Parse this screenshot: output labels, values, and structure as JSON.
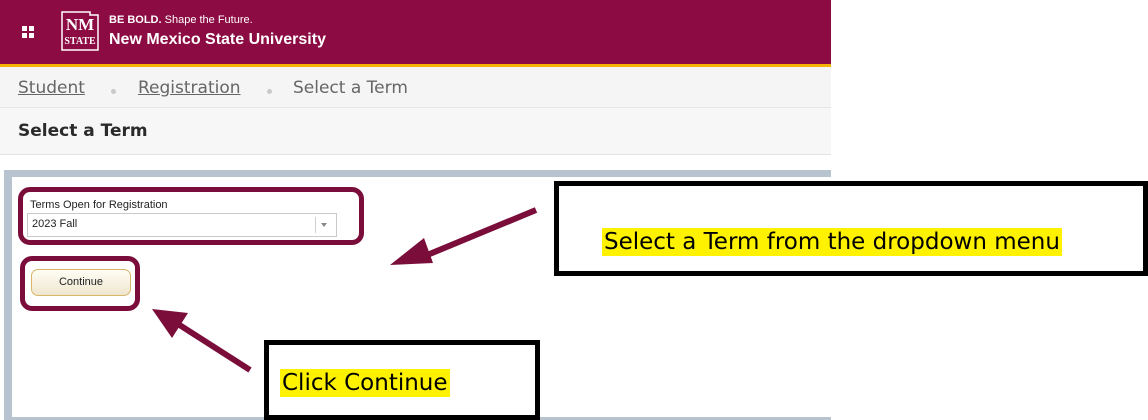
{
  "header": {
    "grid_icon": "app-grid-icon",
    "logo": {
      "letters": "NM",
      "sub": "STATE"
    },
    "tagline_bold": "BE BOLD.",
    "tagline_rest": "Shape the Future.",
    "university_name": "New Mexico State University",
    "brand_color": "#8c0b42",
    "accent_color": "#f4b400"
  },
  "breadcrumb": {
    "items": [
      {
        "label": "Student"
      },
      {
        "label": "Registration"
      },
      {
        "label": "Select a Term"
      }
    ]
  },
  "page": {
    "title": "Select a Term"
  },
  "form": {
    "field_label": "Terms Open for Registration",
    "selected_term": "2023 Fall",
    "continue_label": "Continue"
  },
  "annotations": {
    "callout_dropdown": "Select a Term from the dropdown menu",
    "callout_continue": "Click Continue",
    "highlight_color": "#7a0d3a",
    "callout_highlight": "#fff200"
  }
}
